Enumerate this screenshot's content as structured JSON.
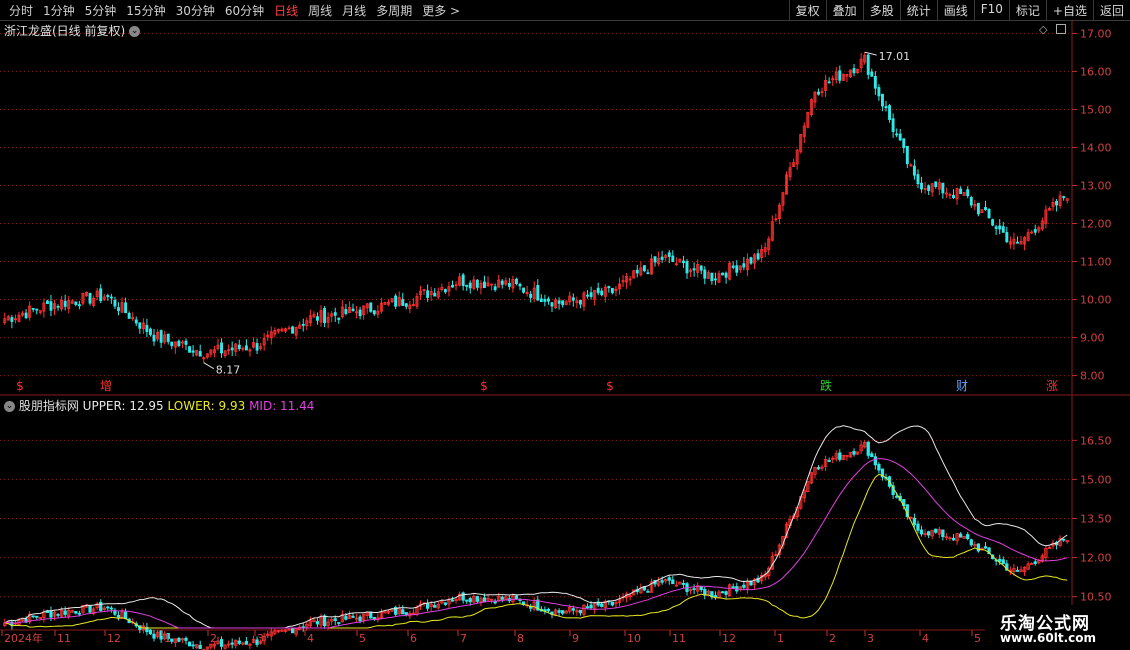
{
  "toolbar": {
    "periods": [
      {
        "label": "分时",
        "active": false
      },
      {
        "label": "1分钟",
        "active": false
      },
      {
        "label": "5分钟",
        "active": false
      },
      {
        "label": "15分钟",
        "active": false
      },
      {
        "label": "30分钟",
        "active": false
      },
      {
        "label": "60分钟",
        "active": false
      },
      {
        "label": "日线",
        "active": true
      },
      {
        "label": "周线",
        "active": false
      },
      {
        "label": "月线",
        "active": false
      },
      {
        "label": "多周期",
        "active": false
      },
      {
        "label": "更多 >",
        "active": false
      }
    ],
    "actions": [
      "复权",
      "叠加",
      "多股",
      "统计",
      "画线",
      "F10",
      "标记",
      "+自选",
      "返回"
    ]
  },
  "main_chart": {
    "title": "浙江龙盛(日线 前复权)",
    "high_marker": "17.01",
    "low_marker": "8.17",
    "events": [
      {
        "label": "$",
        "color": "#ff3030"
      },
      {
        "label": "增",
        "color": "#ff3030"
      },
      {
        "label": "$",
        "color": "#ff3030"
      },
      {
        "label": "$",
        "color": "#ff3030"
      },
      {
        "label": "跌",
        "color": "#30d030"
      },
      {
        "label": "财",
        "color": "#60a0ff"
      },
      {
        "label": "涨",
        "color": "#ff3030"
      }
    ]
  },
  "indicator": {
    "name": "股朋指标网",
    "upper_text": "UPPER: 12.95",
    "lower_text": "LOWER: 9.93",
    "mid_text": "MID: 11.44"
  },
  "chart_data": [
    {
      "type": "candlestick",
      "title": "浙江龙盛(日线 前复权)",
      "y_ticks": [
        "17.00",
        "16.00",
        "15.00",
        "14.00",
        "13.00",
        "12.00",
        "11.00",
        "10.00",
        "9.00",
        "8.00"
      ],
      "ylim": [
        7.7,
        17.3
      ],
      "approx_close_trend": {
        "x_months": [
          "2024年",
          "11",
          "12",
          "1",
          "2",
          "3",
          "4",
          "5",
          "6",
          "7",
          "8",
          "9",
          "10",
          "11",
          "12",
          "1",
          "2",
          "3",
          "4",
          "5"
        ],
        "values": [
          9.5,
          9.9,
          10.1,
          9.0,
          8.6,
          8.8,
          9.5,
          9.7,
          10.0,
          10.5,
          10.4,
          9.9,
          10.2,
          11.1,
          10.6,
          11.2,
          15.5,
          16.3,
          13.1,
          12.7,
          11.4,
          12.8
        ]
      },
      "annotations": [
        "17.01",
        "8.17"
      ]
    },
    {
      "type": "line",
      "title": "股朋指标网",
      "y_ticks": [
        "16.50",
        "15.00",
        "13.50",
        "12.00",
        "10.50"
      ],
      "series": [
        {
          "name": "UPPER",
          "last": 12.95
        },
        {
          "name": "LOWER",
          "last": 9.93
        },
        {
          "name": "MID",
          "last": 11.44
        }
      ],
      "x_labels": [
        "2024年",
        "11",
        "12",
        "1",
        "2",
        "3",
        "4",
        "5",
        "6",
        "7",
        "8",
        "9",
        "10",
        "11",
        "12",
        "1",
        "2",
        "3",
        "4",
        "5"
      ]
    }
  ],
  "watermark": {
    "line1": "乐淘公式网",
    "line2": "www.60lt.com"
  },
  "colors": {
    "up": "#ff3030",
    "down": "#30e8e8",
    "grid": "#8b1a1a",
    "upper": "#e8e8e8",
    "lower": "#e8e820",
    "mid": "#e040e0"
  }
}
